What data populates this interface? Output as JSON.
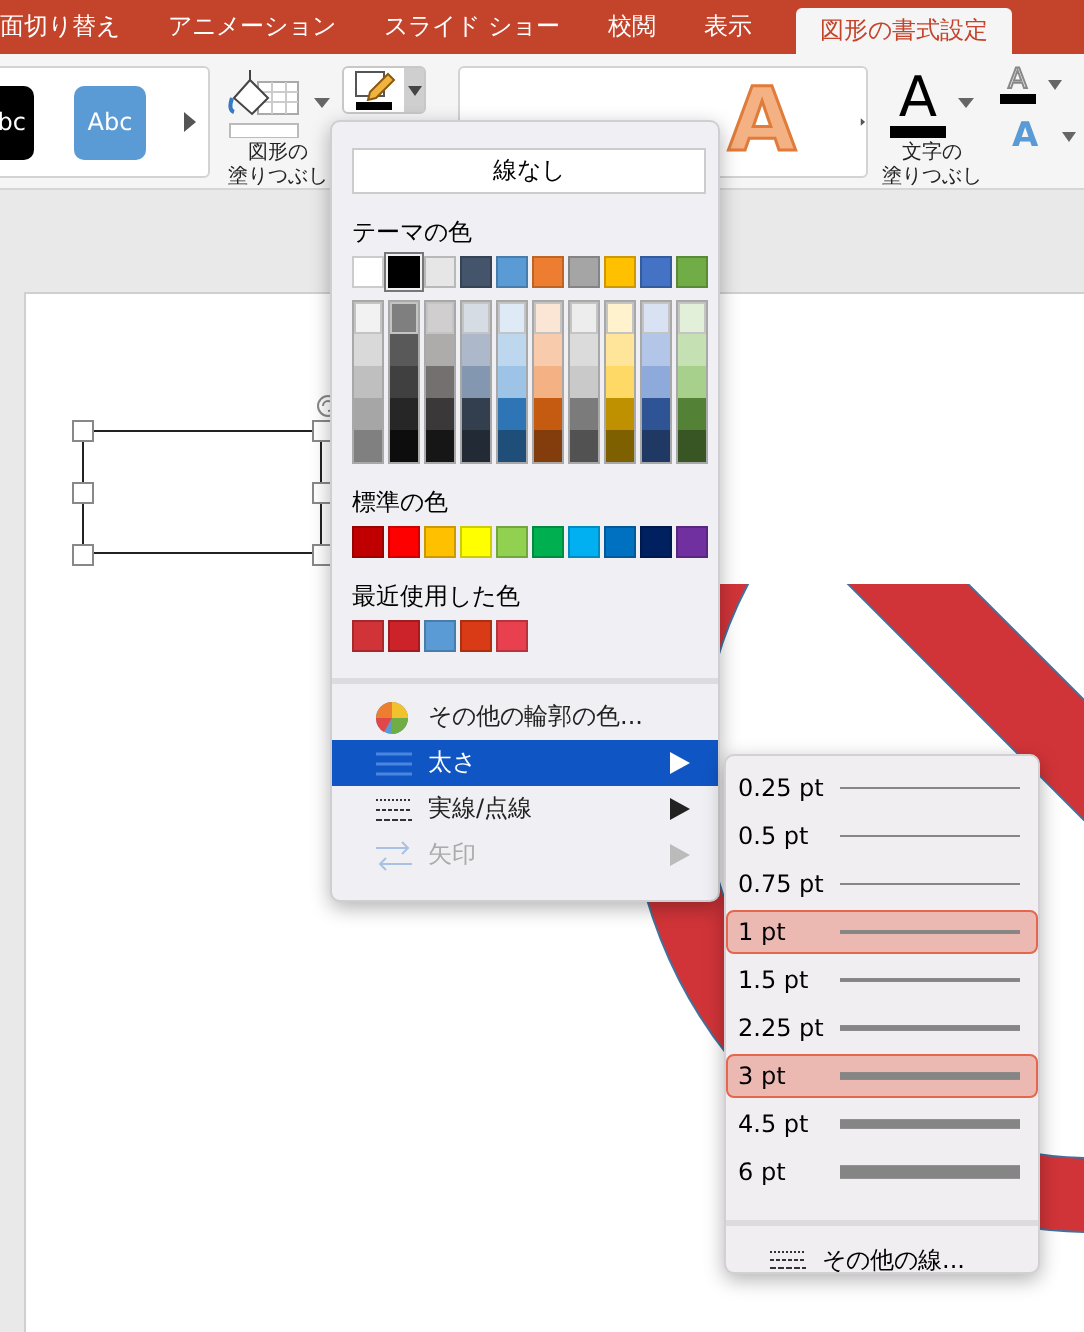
{
  "tabs": [
    {
      "label": "面切り替え",
      "selected": false
    },
    {
      "label": "アニメーション",
      "selected": false
    },
    {
      "label": "スライド ショー",
      "selected": false
    },
    {
      "label": "校閲",
      "selected": false
    },
    {
      "label": "表示",
      "selected": false
    },
    {
      "label": "図形の書式設定",
      "selected": true
    }
  ],
  "ribbon": {
    "shape_styles": [
      {
        "label": "bc",
        "color": "#000000"
      },
      {
        "label": "Abc",
        "color": "#5b9bd5"
      }
    ],
    "shape_fill": {
      "label_lines": [
        "図形の",
        "塗りつぶし"
      ]
    },
    "wordart_styles": [
      {
        "label": "A",
        "color": "#f4b183"
      }
    ],
    "text_fill": {
      "label": "A",
      "label_lines": [
        "文字の",
        "塗りつぶし"
      ]
    },
    "text_outline": {
      "label": "A"
    },
    "text_effects": {
      "label": "A"
    }
  },
  "outline_menu": {
    "no_line": "線なし",
    "theme_heading": "テーマの色",
    "theme_colors": [
      {
        "color": "#ffffff",
        "selected": false
      },
      {
        "color": "#000000",
        "selected": true
      },
      {
        "color": "#e7e6e6",
        "selected": false
      },
      {
        "color": "#44546a",
        "selected": false
      },
      {
        "color": "#5b9bd5",
        "selected": false
      },
      {
        "color": "#ed7d31",
        "selected": false
      },
      {
        "color": "#a5a5a5",
        "selected": false
      },
      {
        "color": "#ffc000",
        "selected": false
      },
      {
        "color": "#4472c4",
        "selected": false
      },
      {
        "color": "#70ad47",
        "selected": false
      }
    ],
    "theme_shades": [
      {
        "colors": [
          {
            "color": "#f2f2f2"
          },
          {
            "color": "#d9d9d9"
          },
          {
            "color": "#bfbfbf"
          },
          {
            "color": "#a6a6a6"
          },
          {
            "color": "#808080"
          }
        ]
      },
      {
        "colors": [
          {
            "color": "#7f7f7f"
          },
          {
            "color": "#595959"
          },
          {
            "color": "#404040"
          },
          {
            "color": "#262626"
          },
          {
            "color": "#0d0d0d"
          }
        ]
      },
      {
        "colors": [
          {
            "color": "#d0cece"
          },
          {
            "color": "#aeabab"
          },
          {
            "color": "#757070"
          },
          {
            "color": "#3a3838"
          },
          {
            "color": "#171616"
          }
        ]
      },
      {
        "colors": [
          {
            "color": "#d6dce4"
          },
          {
            "color": "#adb9ca"
          },
          {
            "color": "#8497b0"
          },
          {
            "color": "#333f4f"
          },
          {
            "color": "#222a35"
          }
        ]
      },
      {
        "colors": [
          {
            "color": "#deebf6"
          },
          {
            "color": "#bdd7ee"
          },
          {
            "color": "#9dc3e6"
          },
          {
            "color": "#2e75b5"
          },
          {
            "color": "#1f4e79"
          }
        ]
      },
      {
        "colors": [
          {
            "color": "#fbe5d5"
          },
          {
            "color": "#f7cbac"
          },
          {
            "color": "#f4b183"
          },
          {
            "color": "#c55a11"
          },
          {
            "color": "#833c0b"
          }
        ]
      },
      {
        "colors": [
          {
            "color": "#ededed"
          },
          {
            "color": "#dbdbdb"
          },
          {
            "color": "#c9c9c9"
          },
          {
            "color": "#7b7b7b"
          },
          {
            "color": "#525252"
          }
        ]
      },
      {
        "colors": [
          {
            "color": "#fff2cc"
          },
          {
            "color": "#fee599"
          },
          {
            "color": "#ffd965"
          },
          {
            "color": "#bf9000"
          },
          {
            "color": "#7f6000"
          }
        ]
      },
      {
        "colors": [
          {
            "color": "#d9e2f3"
          },
          {
            "color": "#b4c6e7"
          },
          {
            "color": "#8eaadb"
          },
          {
            "color": "#2f5496"
          },
          {
            "color": "#1f3864"
          }
        ]
      },
      {
        "colors": [
          {
            "color": "#e2efd9"
          },
          {
            "color": "#c5e0b3"
          },
          {
            "color": "#a8d08d"
          },
          {
            "color": "#538135"
          },
          {
            "color": "#375623"
          }
        ]
      }
    ],
    "standard_heading": "標準の色",
    "standard_colors": [
      {
        "color": "#c00000"
      },
      {
        "color": "#ff0000"
      },
      {
        "color": "#ffc000"
      },
      {
        "color": "#ffff00"
      },
      {
        "color": "#92d050"
      },
      {
        "color": "#00b050"
      },
      {
        "color": "#00b0f0"
      },
      {
        "color": "#0070c0"
      },
      {
        "color": "#002060"
      },
      {
        "color": "#7030a0"
      }
    ],
    "recent_heading": "最近使用した色",
    "recent_colors": [
      {
        "color": "#d13438"
      },
      {
        "color": "#cc2229"
      },
      {
        "color": "#5b9bd5"
      },
      {
        "color": "#d83b16"
      },
      {
        "color": "#e8404f"
      }
    ],
    "items": [
      {
        "label": "その他の輪郭の色...",
        "kind": "palette",
        "selected": false,
        "disabled": false,
        "submenu": false
      },
      {
        "label": "太さ",
        "kind": "weight",
        "selected": true,
        "disabled": false,
        "submenu": true
      },
      {
        "label": "実線/点線",
        "kind": "dash",
        "selected": false,
        "disabled": false,
        "submenu": true
      },
      {
        "label": "矢印",
        "kind": "arrow",
        "selected": false,
        "disabled": true,
        "submenu": true
      }
    ]
  },
  "weight_menu": {
    "items": [
      {
        "label": "0.25 pt",
        "selected": false
      },
      {
        "label": "0.5 pt",
        "selected": false
      },
      {
        "label": "0.75 pt",
        "selected": false
      },
      {
        "label": "1 pt",
        "selected": true
      },
      {
        "label": "1.5 pt",
        "selected": false
      },
      {
        "label": "2.25 pt",
        "selected": false
      },
      {
        "label": "3 pt",
        "selected": true
      },
      {
        "label": "4.5 pt",
        "selected": false
      },
      {
        "label": "6 pt",
        "selected": false
      }
    ],
    "more": "その他の線..."
  }
}
